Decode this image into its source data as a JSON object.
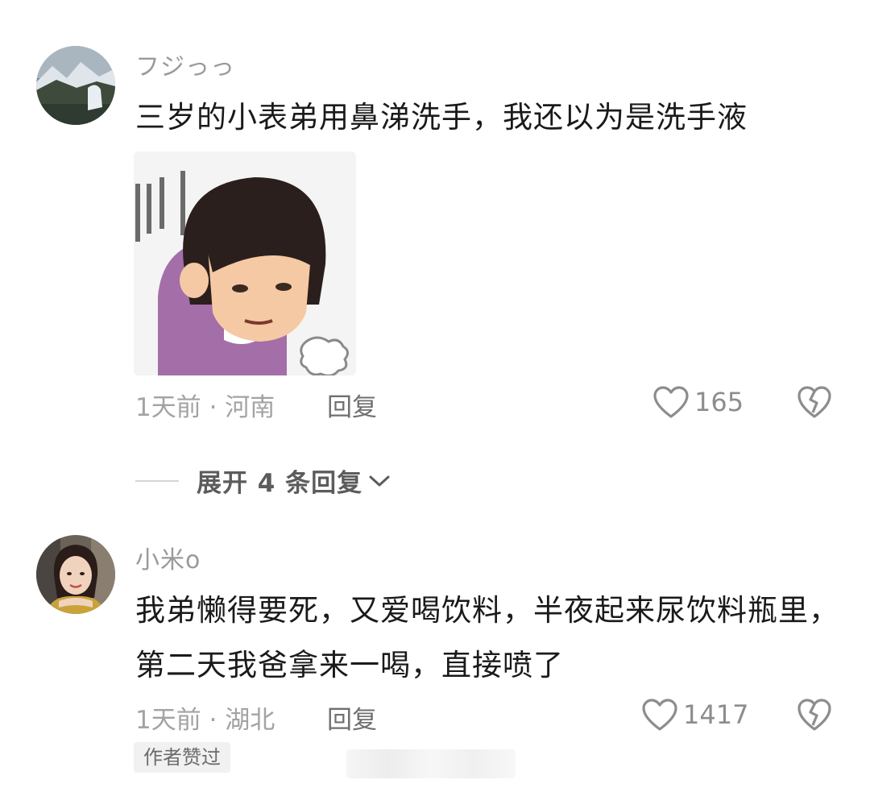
{
  "comments": [
    {
      "username": "フジっっ",
      "text": "三岁的小表弟用鼻涕洗手，我还以为是洗手液",
      "time_location": "1天前 · 河南",
      "reply_label": "回复",
      "likes": "165",
      "avatar_icon": "mountain-landscape-avatar",
      "sticker_icon": "girl-bowing-meme-sticker"
    },
    {
      "username": "小米o",
      "text": "我弟懒得要死，又爱喝饮料，半夜起来尿饮料瓶里，第二天我爸拿来一喝，直接喷了",
      "time_location": "1天前 · 湖北",
      "reply_label": "回复",
      "likes": "1417",
      "badge": "作者赞过",
      "avatar_icon": "woman-portrait-avatar"
    }
  ],
  "expand_replies": "展开 4 条回复",
  "colors": {
    "username": "#9a9a9a",
    "text": "#1a1a1a",
    "meta": "#a3a3a3",
    "sticker_sweater": "#a46ea8",
    "sticker_hair": "#2b1f1d"
  }
}
